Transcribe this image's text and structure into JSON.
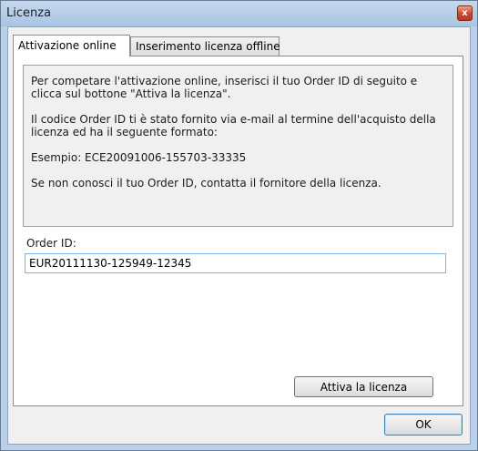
{
  "window": {
    "title": "Licenza",
    "close_label": "x"
  },
  "tabs": [
    {
      "label": "Attivazione online",
      "selected": true
    },
    {
      "label": "Inserimento licenza offline",
      "selected": false
    }
  ],
  "info": {
    "paragraph1": "Per competare l'attivazione online, inserisci il tuo Order ID di seguito e clicca sul bottone \"Attiva la licenza\".",
    "paragraph2": "Il codice Order ID ti è stato fornito via e-mail al termine dell'acquisto della licenza ed ha il seguente formato:",
    "paragraph3": "Esempio: ECE20091006-155703-33335",
    "paragraph4": "Se non conosci il tuo Order ID, contatta il fornitore della licenza."
  },
  "order": {
    "label": "Order ID:",
    "value": "EUR20111130-125949-12345"
  },
  "buttons": {
    "activate_label": "Attiva la licenza",
    "ok_label": "OK"
  },
  "colors": {
    "window_frame": "#b9d1ea",
    "client_bg": "#f0f0f0",
    "close_button": "#c8442c",
    "input_border": "#7eb4ea"
  }
}
